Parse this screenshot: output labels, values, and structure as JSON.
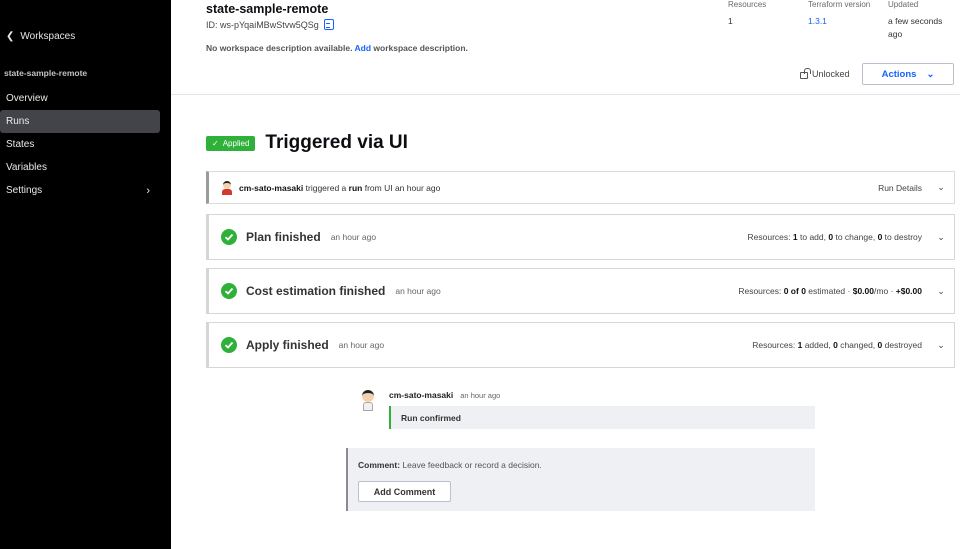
{
  "sidebar": {
    "back_label": "Workspaces",
    "workspace_name": "state-sample-remote",
    "items": [
      {
        "label": "Overview"
      },
      {
        "label": "Runs"
      },
      {
        "label": "States"
      },
      {
        "label": "Variables"
      },
      {
        "label": "Settings"
      }
    ]
  },
  "header": {
    "title": "state-sample-remote",
    "id_text": "ID: ws-pYqaiMBwStvw5QSg",
    "desc_prefix": "No workspace description available.",
    "desc_link": "Add",
    "desc_suffix": "workspace description.",
    "meta": {
      "resources_label": "Resources",
      "resources_value": "1",
      "tf_label": "Terraform version",
      "tf_value": "1.3.1",
      "updated_label": "Updated",
      "updated_value": "a few seconds ago"
    },
    "lock_status": "Unlocked",
    "actions_label": "Actions"
  },
  "run": {
    "status_badge": "Applied",
    "title": "Triggered via UI",
    "trigger": {
      "user": "cm-sato-masaki",
      "text1": "triggered a",
      "run_word": "run",
      "text2": "from UI an hour ago",
      "details_label": "Run Details"
    },
    "steps": {
      "plan": {
        "title": "Plan finished",
        "time": "an hour ago",
        "s1": "Resources:",
        "n1": "1",
        "s2": "to add,",
        "n2": "0",
        "s3": "to change,",
        "n3": "0",
        "s4": "to destroy"
      },
      "cost": {
        "title": "Cost estimation finished",
        "time": "an hour ago",
        "s1": "Resources:",
        "n1": "0 of 0",
        "s2": "estimated ·",
        "n2": "$0.00",
        "s3": "/mo ·",
        "n3": "+$0.00"
      },
      "apply": {
        "title": "Apply finished",
        "time": "an hour ago",
        "s1": "Resources:",
        "n1": "1",
        "s2": "added,",
        "n2": "0",
        "s3": "changed,",
        "n3": "0",
        "s4": "destroyed"
      }
    },
    "confirmation": {
      "user": "cm-sato-masaki",
      "time": "an hour ago",
      "message": "Run confirmed"
    },
    "comment": {
      "label": "Comment:",
      "placeholder": "Leave feedback or record a decision.",
      "button": "Add Comment"
    }
  }
}
